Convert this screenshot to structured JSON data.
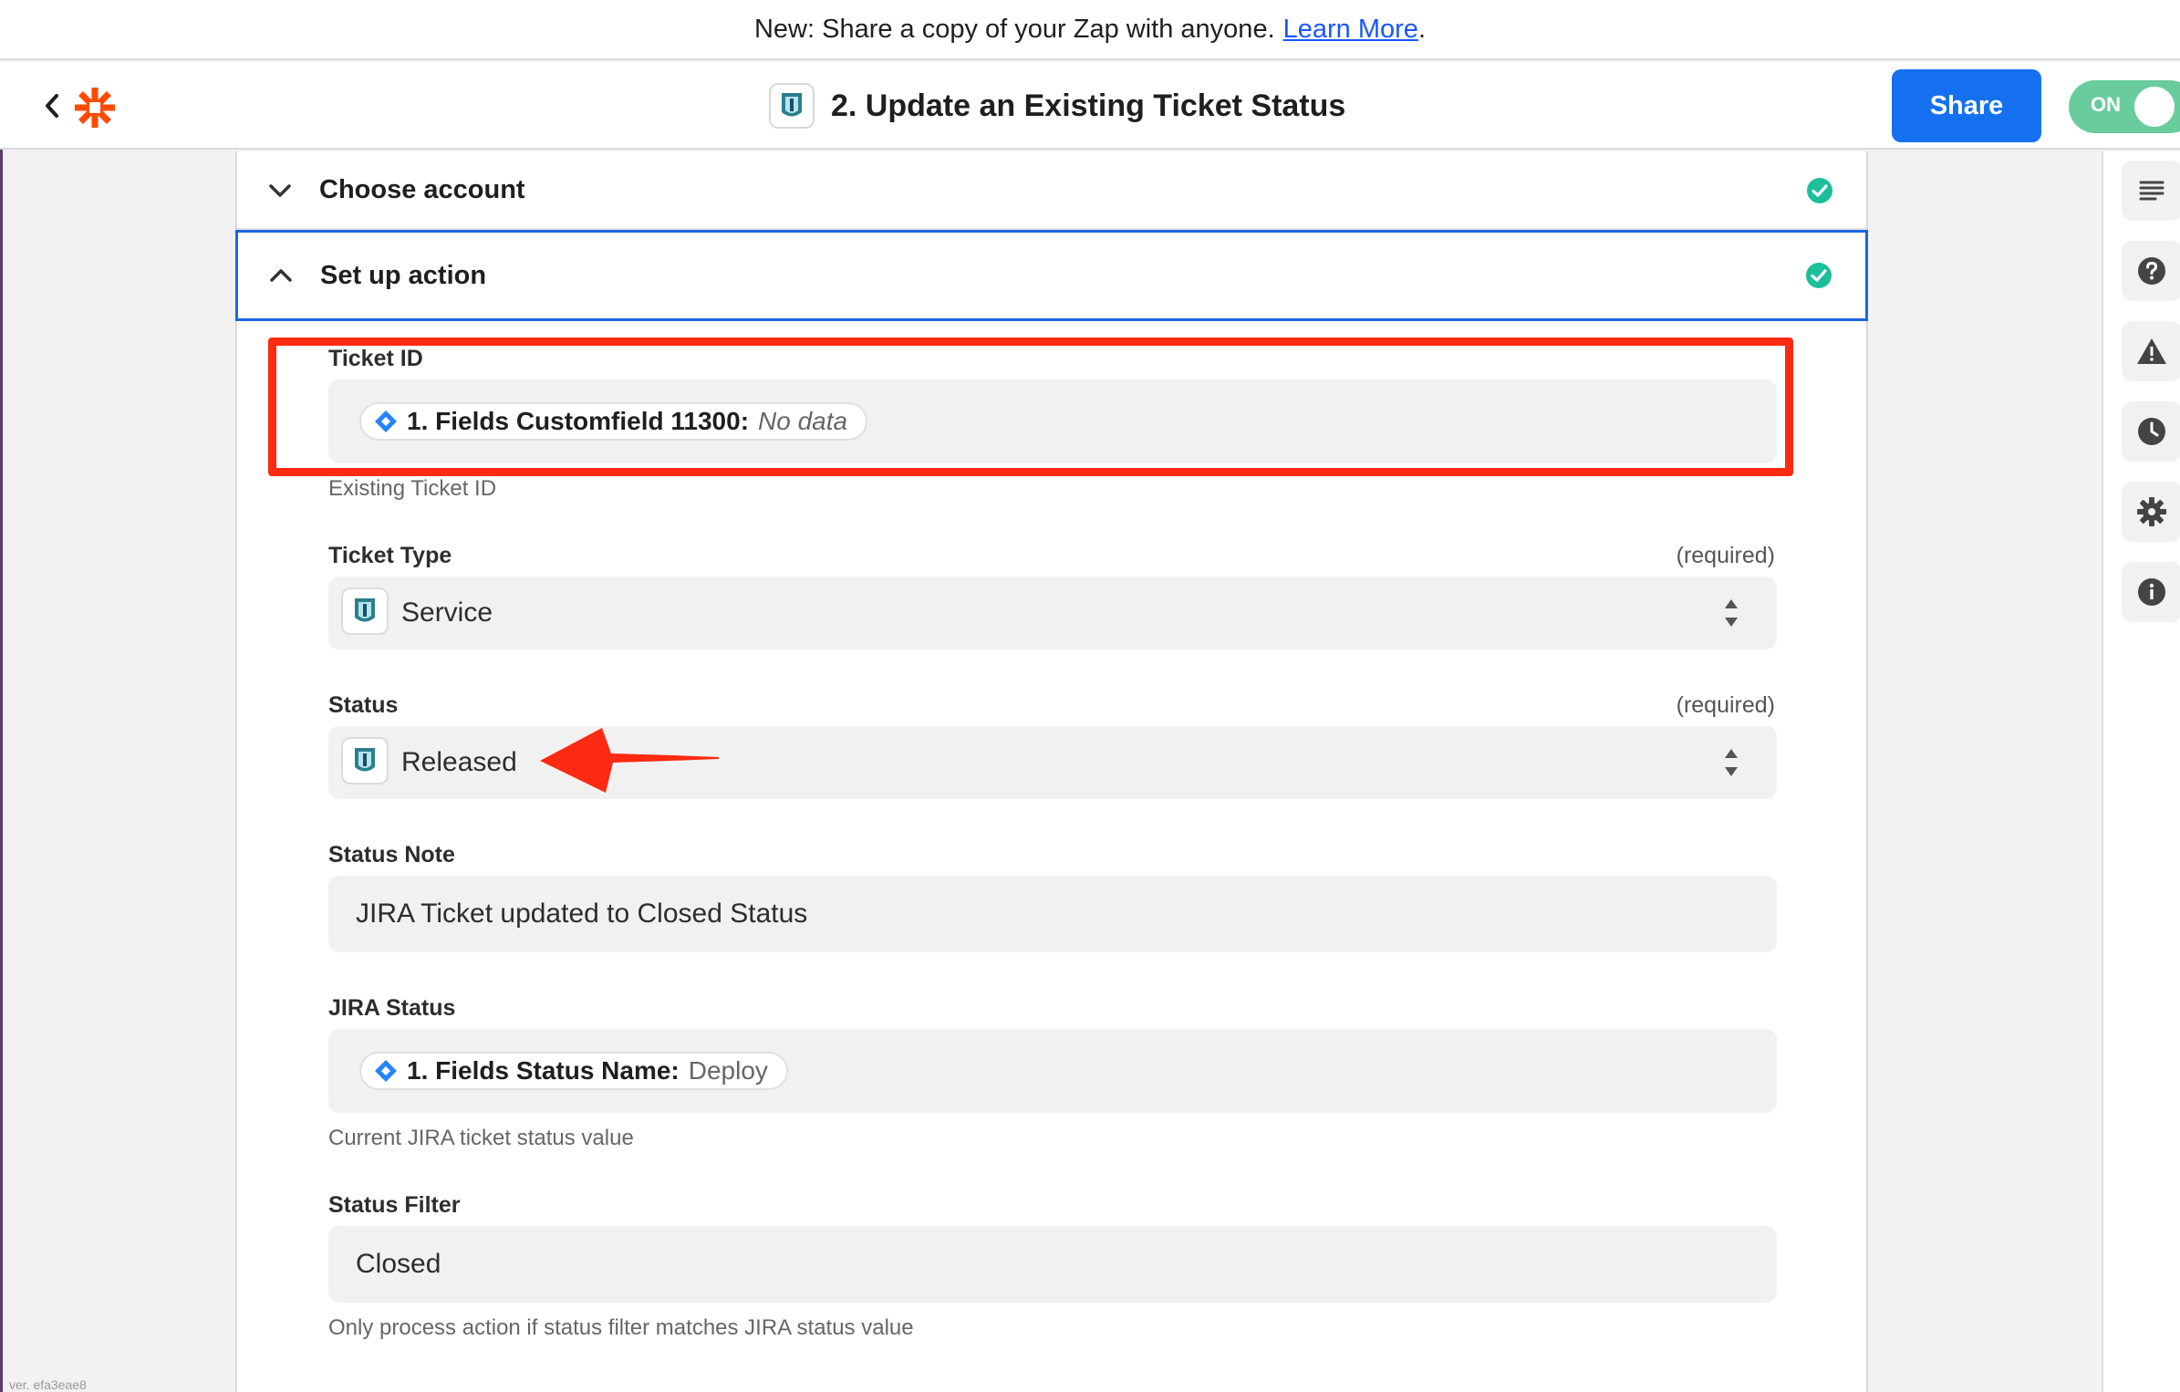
{
  "banner": {
    "text": "New: Share a copy of your Zap with anyone.",
    "link": "Learn More",
    "suffix": "."
  },
  "header": {
    "title": "2. Update an Existing Ticket Status",
    "share_label": "Share",
    "toggle_label": "ON"
  },
  "sections": {
    "choose_account": "Choose account",
    "setup_action": "Set up action"
  },
  "fields": {
    "ticket_id": {
      "label": "Ticket ID",
      "pill_key": "1. Fields Customfield 11300:",
      "pill_value": "No data",
      "help": "Existing Ticket ID"
    },
    "ticket_type": {
      "label": "Ticket Type",
      "required": "(required)",
      "value": "Service"
    },
    "status": {
      "label": "Status",
      "required": "(required)",
      "value": "Released"
    },
    "status_note": {
      "label": "Status Note",
      "value": "JIRA Ticket updated to Closed Status"
    },
    "jira_status": {
      "label": "JIRA Status",
      "pill_key": "1. Fields Status Name:",
      "pill_value": "Deploy",
      "help": "Current JIRA ticket status value"
    },
    "status_filter": {
      "label": "Status Filter",
      "value": "Closed",
      "help": "Only process action if status filter matches JIRA status value"
    }
  },
  "footer": {
    "version": "ver. efa3eae8"
  },
  "colors": {
    "accent": "#1570ef",
    "toggle": "#69cc9c",
    "check": "#1dbf9a",
    "zapier_orange": "#ff4a00",
    "annotation_red": "#ff2a12",
    "jira_blue": "#2684ff"
  },
  "icons": {
    "back": "chevron-left-icon",
    "logo": "zapier-logo",
    "app": "ticket-app-icon",
    "sidebar": [
      "outline-icon",
      "help-icon",
      "warning-icon",
      "history-icon",
      "settings-icon",
      "info-icon"
    ]
  }
}
